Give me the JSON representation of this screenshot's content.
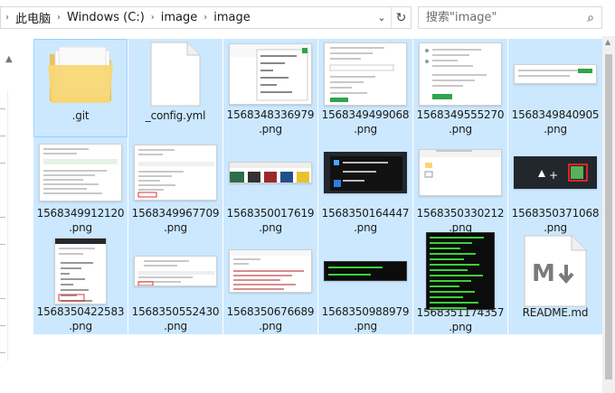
{
  "address": {
    "breadcrumbs": [
      "此电脑",
      "Windows (C:)",
      "image",
      "image"
    ],
    "refresh_icon": "refresh-icon",
    "dropdown_icon": "chevron-down-icon"
  },
  "search": {
    "placeholder": "搜索\"image\"",
    "icon": "search-icon"
  },
  "items": [
    {
      "name": ".git",
      "kind": "folder"
    },
    {
      "name": "_config.yml",
      "kind": "file"
    },
    {
      "name": "1568348336979\n.png",
      "kind": "png",
      "variant": "menu"
    },
    {
      "name": "1568349499068\n.png",
      "kind": "png",
      "variant": "form"
    },
    {
      "name": "1568349555270\n.png",
      "kind": "png",
      "variant": "form2"
    },
    {
      "name": "1568349840905\n.png",
      "kind": "png",
      "variant": "thin"
    },
    {
      "name": "1568349912120\n.png",
      "kind": "png",
      "variant": "page"
    },
    {
      "name": "1568349967709\n.png",
      "kind": "png",
      "variant": "page2"
    },
    {
      "name": "1568350017619\n.png",
      "kind": "png",
      "variant": "strip"
    },
    {
      "name": "1568350164447\n.png",
      "kind": "png",
      "variant": "darkmenu"
    },
    {
      "name": "1568350330212\n.png",
      "kind": "png",
      "variant": "explorer"
    },
    {
      "name": "1568350371068\n.png",
      "kind": "png",
      "variant": "toolbar"
    },
    {
      "name": "1568350422583\n.png",
      "kind": "png",
      "variant": "dropdown"
    },
    {
      "name": "1568350552430\n.png",
      "kind": "png",
      "variant": "page3"
    },
    {
      "name": "1568350676689\n.png",
      "kind": "png",
      "variant": "page4"
    },
    {
      "name": "1568350988979\n.png",
      "kind": "png",
      "variant": "termsmall"
    },
    {
      "name": "1568351174357\n.png",
      "kind": "png",
      "variant": "term"
    },
    {
      "name": "README.md",
      "kind": "markdown"
    }
  ],
  "colors": {
    "selection": "#cce8ff",
    "folder": "#f8d775",
    "link": "#0366d6",
    "terminal_green": "#3bd13b"
  }
}
